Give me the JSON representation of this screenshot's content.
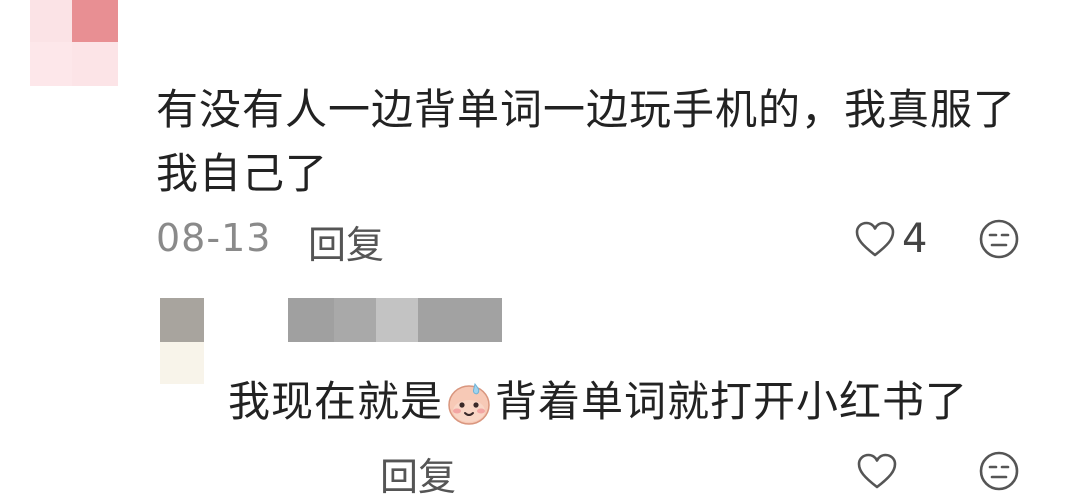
{
  "comment": {
    "text": "有没有人一边背单词一边玩手机的，我真服了我自己了",
    "date": "08-13",
    "reply_label": "回复",
    "like_count": "4",
    "like_icon": "heart-outline-icon",
    "dislike_icon": "neutral-face-icon"
  },
  "reply": {
    "text_before": "我现在就是",
    "emoji": "sweating-smile-emoji",
    "text_after": "背着单词就打开小红书了",
    "reply_label": "回复",
    "like_icon": "heart-outline-icon",
    "dislike_icon": "neutral-face-icon"
  },
  "colors": {
    "text": "#222222",
    "secondary": "#8a8a8a",
    "avatar_pink": "#e88f93",
    "avatar_grey": "#a0a0a0"
  }
}
